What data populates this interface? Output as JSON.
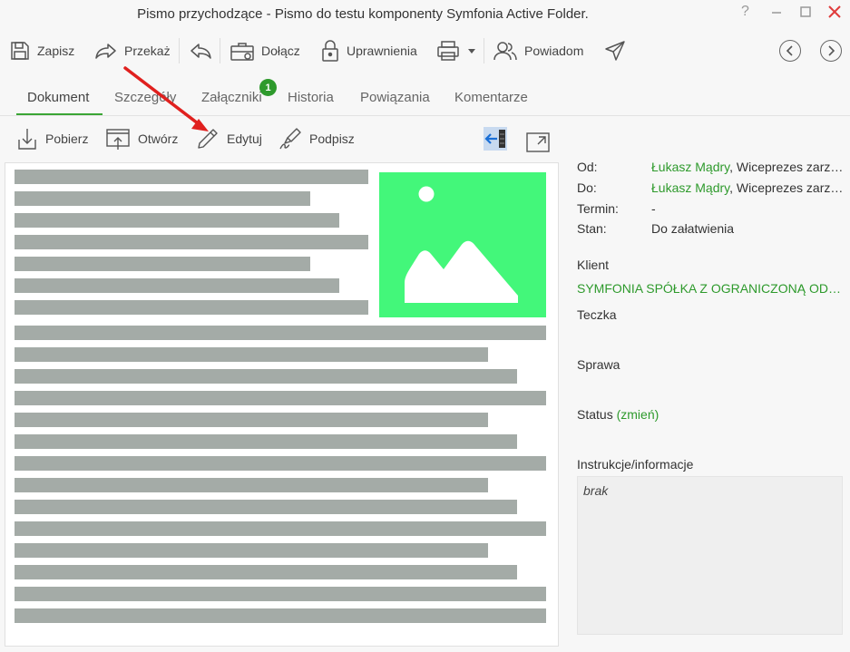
{
  "window": {
    "title": "Pismo przychodzące - Pismo do testu komponenty Symfonia Active Folder.",
    "help_glyph": "?"
  },
  "toolbar": {
    "save": "Zapisz",
    "forward": "Przekaż",
    "attach": "Dołącz",
    "permissions": "Uprawnienia",
    "notify": "Powiadom"
  },
  "tabs": [
    {
      "label": "Dokument",
      "active": true
    },
    {
      "label": "Szczegóły",
      "active": false
    },
    {
      "label": "Załączniki",
      "active": false,
      "badge": "1"
    },
    {
      "label": "Historia",
      "active": false
    },
    {
      "label": "Powiązania",
      "active": false
    },
    {
      "label": "Komentarze",
      "active": false
    }
  ],
  "doc_toolbar": {
    "download": "Pobierz",
    "open": "Otwórz",
    "edit": "Edytuj",
    "sign": "Podpisz"
  },
  "meta": {
    "from_label": "Od:",
    "from_name": "Łukasz Mądry",
    "from_role": ", Wiceprezes zarządu",
    "to_label": "Do:",
    "to_name": "Łukasz Mądry",
    "to_role": ", Wiceprezes zarządu",
    "due_label": "Termin:",
    "due_value": "-",
    "state_label": "Stan:",
    "state_value": "Do załatwienia",
    "client_label": "Klient",
    "client_value": "SYMFONIA SPÓŁKA Z OGRANICZONĄ ODPOWIEDZIALNOŚCIĄ",
    "folder_label": "Teczka",
    "case_label": "Sprawa",
    "status_label": "Status",
    "status_change": "(zmień)",
    "instructions_label": "Instrukcje/informacje",
    "instructions_value": "brak"
  },
  "colors": {
    "accent": "#3aa535",
    "badge": "#2e9a2c",
    "image_placeholder": "#43f77a",
    "text_placeholder": "#a4aba7",
    "close": "#e03c3c",
    "annotation_arrow": "#e0201e"
  }
}
